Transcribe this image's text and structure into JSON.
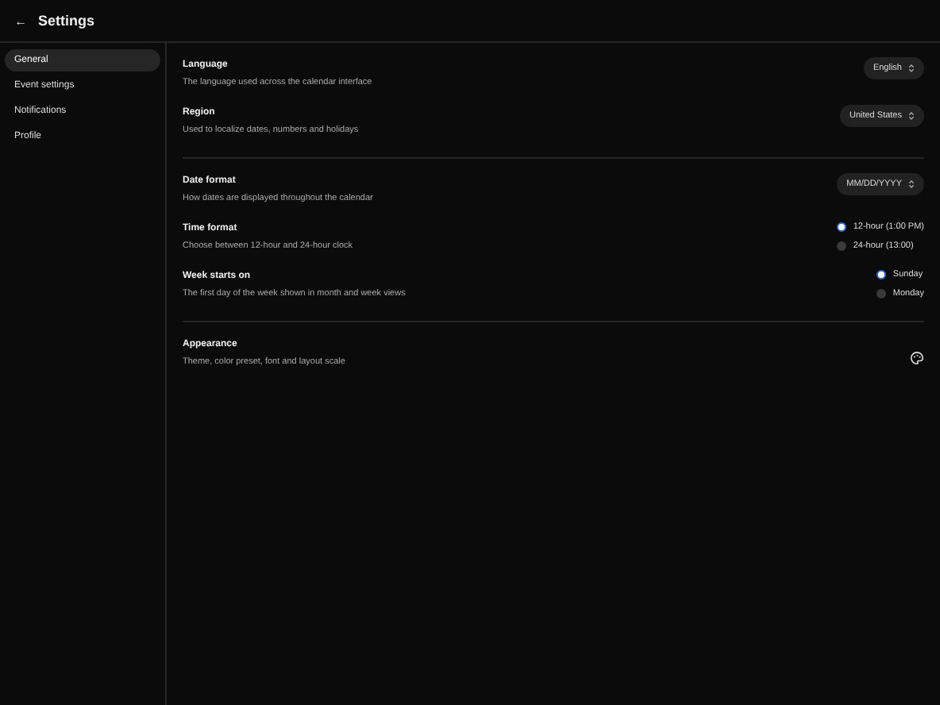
{
  "header": {
    "back_icon": "←",
    "title": "Settings"
  },
  "sidebar": {
    "items": [
      {
        "label": "General",
        "selected": true
      },
      {
        "label": "Event settings",
        "selected": false
      },
      {
        "label": "Notifications",
        "selected": false
      },
      {
        "label": "Profile",
        "selected": false
      }
    ]
  },
  "groups": [
    {
      "rows": [
        {
          "kind": "select",
          "title": "Language",
          "description": "The language used across the calendar interface",
          "value": "English"
        },
        {
          "kind": "select",
          "title": "Region",
          "description": "Used to localize dates, numbers and holidays",
          "value": "United States"
        }
      ]
    },
    {
      "rows": [
        {
          "kind": "select",
          "title": "Date format",
          "description": "How dates are displayed throughout the calendar",
          "value": "MM/DD/YYYY"
        },
        {
          "kind": "radio",
          "title": "Time format",
          "description": "Choose between 12-hour and 24-hour clock",
          "options": [
            {
              "label": "12-hour (1:00 PM)",
              "selected": true
            },
            {
              "label": "24-hour (13:00)",
              "selected": false
            }
          ]
        },
        {
          "kind": "radio",
          "title": "Week starts on",
          "description": "The first day of the week shown in month and week views",
          "options": [
            {
              "label": "Sunday",
              "selected": true
            },
            {
              "label": "Monday",
              "selected": false
            }
          ]
        }
      ]
    },
    {
      "rows": [
        {
          "kind": "icon",
          "title": "Appearance",
          "description": "Theme, color preset, font and layout scale"
        }
      ]
    }
  ]
}
